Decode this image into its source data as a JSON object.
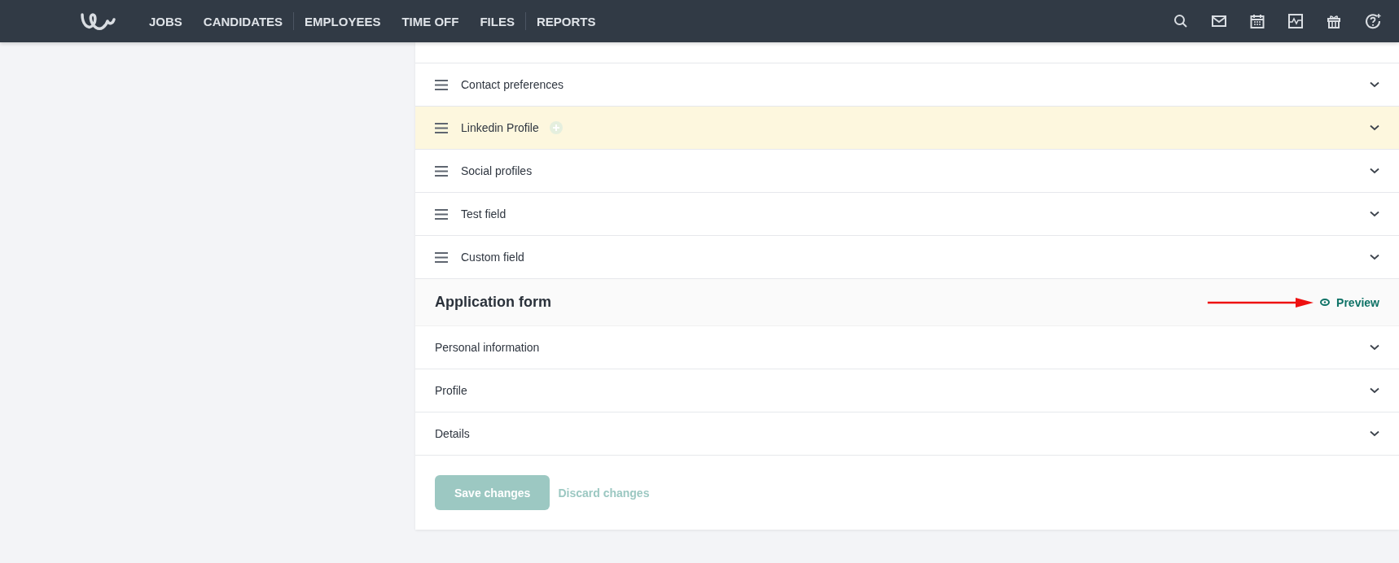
{
  "nav": {
    "items": [
      {
        "label": "JOBS",
        "divider_after": false
      },
      {
        "label": "CANDIDATES",
        "divider_after": true
      },
      {
        "label": "EMPLOYEES",
        "divider_after": false
      },
      {
        "label": "TIME OFF",
        "divider_after": false
      },
      {
        "label": "FILES",
        "divider_after": true
      },
      {
        "label": "REPORTS",
        "divider_after": false
      }
    ]
  },
  "fields": [
    {
      "label": "Contact preferences",
      "highlighted": false,
      "addable": false
    },
    {
      "label": "Linkedin Profile",
      "highlighted": true,
      "addable": true
    },
    {
      "label": "Social profiles",
      "highlighted": false,
      "addable": false
    },
    {
      "label": "Test field",
      "highlighted": false,
      "addable": false
    },
    {
      "label": "Custom field",
      "highlighted": false,
      "addable": false
    }
  ],
  "application_form": {
    "title": "Application form",
    "preview": "Preview",
    "sections": [
      "Personal information",
      "Profile",
      "Details"
    ]
  },
  "buttons": [
    {
      "label": "Save changes",
      "kind": "primary",
      "disabled": true
    },
    {
      "label": "Discard changes",
      "kind": "link",
      "disabled": true
    }
  ]
}
